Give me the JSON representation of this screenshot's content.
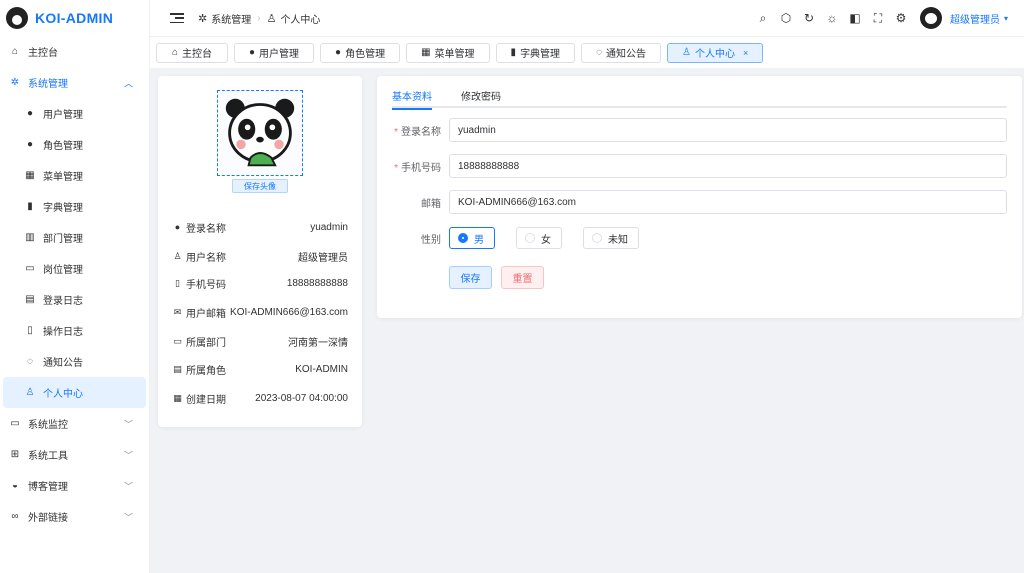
{
  "app": {
    "title": "KOI-ADMIN"
  },
  "sidebar": {
    "items": [
      {
        "label": "主控台",
        "icon": "home-icon"
      },
      {
        "label": "系统管理",
        "icon": "gear-icon",
        "expanded": true
      },
      {
        "label": "用户管理",
        "icon": "user-icon"
      },
      {
        "label": "角色管理",
        "icon": "user-icon"
      },
      {
        "label": "菜单管理",
        "icon": "grid-icon"
      },
      {
        "label": "字典管理",
        "icon": "book-icon"
      },
      {
        "label": "部门管理",
        "icon": "bar-chart-icon"
      },
      {
        "label": "岗位管理",
        "icon": "id-card-icon"
      },
      {
        "label": "登录日志",
        "icon": "calendar-icon"
      },
      {
        "label": "操作日志",
        "icon": "notebook-icon"
      },
      {
        "label": "通知公告",
        "icon": "chat-icon"
      },
      {
        "label": "个人中心",
        "icon": "user-outline-icon",
        "active": true
      },
      {
        "label": "系统监控",
        "icon": "monitor-icon"
      },
      {
        "label": "系统工具",
        "icon": "toolbox-icon"
      },
      {
        "label": "博客管理",
        "icon": "bowl-icon"
      },
      {
        "label": "外部链接",
        "icon": "link-icon"
      }
    ]
  },
  "header": {
    "breadcrumb": [
      "系统管理",
      "个人中心"
    ],
    "tools": [
      "search-icon",
      "theme-icon",
      "refresh-icon",
      "sun-icon",
      "switch-icon",
      "fullscreen-icon",
      "settings-icon"
    ],
    "user_name": "超级管理员"
  },
  "tabs": [
    {
      "label": "主控台",
      "icon": "home-icon"
    },
    {
      "label": "用户管理",
      "icon": "user-icon"
    },
    {
      "label": "角色管理",
      "icon": "user-icon"
    },
    {
      "label": "菜单管理",
      "icon": "grid-icon"
    },
    {
      "label": "字典管理",
      "icon": "book-icon"
    },
    {
      "label": "通知公告",
      "icon": "chat-icon"
    },
    {
      "label": "个人中心",
      "icon": "user-outline-icon",
      "active": true,
      "close": "×"
    }
  ],
  "profile": {
    "save_avatar_label": "保存头像",
    "rows": [
      {
        "label": "登录名称",
        "value": "yuadmin"
      },
      {
        "label": "用户名称",
        "value": "超级管理员"
      },
      {
        "label": "手机号码",
        "value": "18888888888"
      },
      {
        "label": "用户邮箱",
        "value": "KOI-ADMIN666@163.com"
      },
      {
        "label": "所属部门",
        "value": "河南第一深情"
      },
      {
        "label": "所属角色",
        "value": "KOI-ADMIN"
      },
      {
        "label": "创建日期",
        "value": "2023-08-07 04:00:00"
      }
    ]
  },
  "form": {
    "tabs": [
      "基本资料",
      "修改密码"
    ],
    "fields": [
      {
        "label": "登录名称",
        "required": "*",
        "value": "yuadmin"
      },
      {
        "label": "手机号码",
        "required": "*",
        "value": "18888888888"
      },
      {
        "label": "邮箱",
        "value": "KOI-ADMIN666@163.com"
      }
    ],
    "gender": {
      "label": "性别",
      "options": [
        "男",
        "女",
        "未知"
      ],
      "selected": "男"
    },
    "save_label": "保存",
    "reset_label": "重置"
  },
  "colors": {
    "primary": "#1677ff",
    "danger": "#f56c6c",
    "active_bg": "#e6f1ff"
  }
}
